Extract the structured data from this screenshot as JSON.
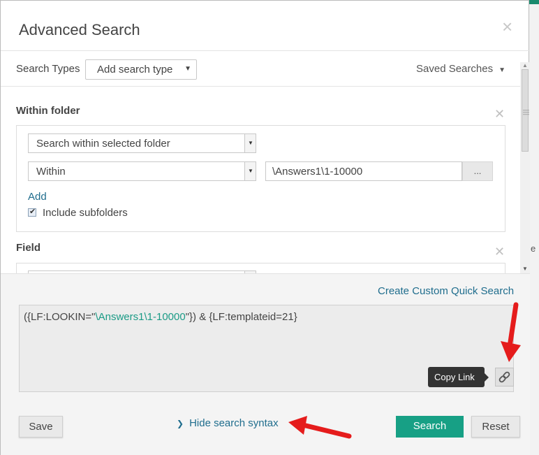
{
  "dialog": {
    "title": "Advanced Search",
    "close_glyph": "×"
  },
  "toolbar": {
    "search_types_label": "Search Types",
    "add_search_type": "Add search type",
    "saved_searches": "Saved Searches"
  },
  "within_folder": {
    "title": "Within folder",
    "scope_select": "Search within selected folder",
    "within_select": "Within",
    "path_value": "\\Answers1\\1-10000",
    "browse_label": "...",
    "add_label": "Add",
    "include_subfolders_label": "Include subfolders",
    "include_subfolders_checked": true
  },
  "field_section": {
    "title": "Field"
  },
  "lower": {
    "create_custom_quick_search": "Create Custom Quick Search",
    "syntax_prefix": "({LF:LOOKIN=\"",
    "syntax_path": "\\Answers1\\1-10000",
    "syntax_suffix": "\"}) & {LF:templateid=21}",
    "copy_link_tooltip": "Copy Link",
    "hide_syntax_label": "Hide search syntax",
    "save_label": "Save",
    "search_label": "Search",
    "reset_label": "Reset"
  },
  "background": {
    "edge_char": "e"
  },
  "colors": {
    "accent_teal": "#17a085",
    "link_blue": "#1f6d8d",
    "annotation_red": "#e51c1c"
  }
}
